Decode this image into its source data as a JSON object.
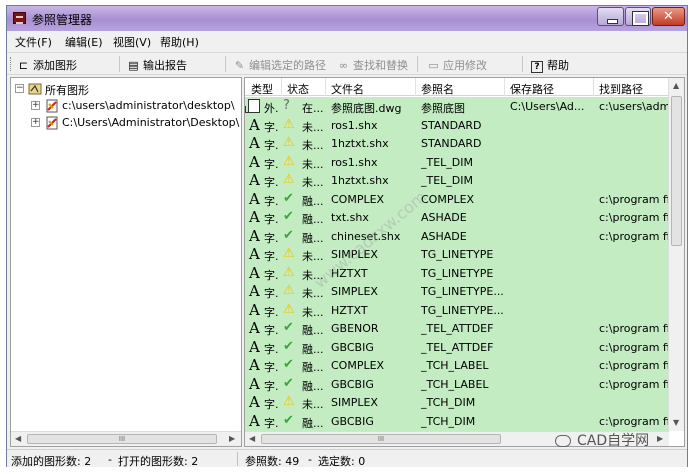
{
  "window": {
    "title": "参照管理器"
  },
  "menu": [
    {
      "label": "文件(F)"
    },
    {
      "label": "编辑(E)"
    },
    {
      "label": "视图(V)"
    },
    {
      "label": "帮助(H)"
    }
  ],
  "toolbar": {
    "add_drawing": "添加图形",
    "output_report": "输出报告",
    "edit_selected_path": "编辑选定的路径",
    "find_replace": "查找和替换",
    "apply_changes": "应用修改",
    "help": "帮助"
  },
  "tree": {
    "root_label": "所有图形",
    "items": [
      {
        "label": "c:\\users\\administrator\\desktop\\"
      },
      {
        "label": "C:\\Users\\Administrator\\Desktop\\"
      }
    ]
  },
  "list": {
    "columns": [
      "类型",
      "状态",
      "文件名",
      "参照名",
      "保存路径",
      "找到路径"
    ],
    "rows": [
      {
        "type_icon": "document-icon",
        "type": "外.",
        "status_icon": "question-icon",
        "status": "在...",
        "file": "参照底图.dwg",
        "ref": "参照底图",
        "save_path": "C:\\Users\\Ad...",
        "found_path": "c:\\users\\admir"
      },
      {
        "type_icon": "font-icon",
        "type": "字.",
        "status_icon": "warning-icon",
        "status": "未...",
        "file": "ros1.shx",
        "ref": "STANDARD",
        "save_path": "",
        "found_path": ""
      },
      {
        "type_icon": "font-icon",
        "type": "字.",
        "status_icon": "warning-icon",
        "status": "未...",
        "file": "1hztxt.shx",
        "ref": "STANDARD",
        "save_path": "",
        "found_path": ""
      },
      {
        "type_icon": "font-icon",
        "type": "字.",
        "status_icon": "warning-icon",
        "status": "未...",
        "file": "ros1.shx",
        "ref": "_TEL_DIM",
        "save_path": "",
        "found_path": ""
      },
      {
        "type_icon": "font-icon",
        "type": "字.",
        "status_icon": "warning-icon",
        "status": "未...",
        "file": "1hztxt.shx",
        "ref": "_TEL_DIM",
        "save_path": "",
        "found_path": ""
      },
      {
        "type_icon": "font-icon",
        "type": "字.",
        "status_icon": "check-icon",
        "status": "融...",
        "file": "COMPLEX",
        "ref": "COMPLEX",
        "save_path": "",
        "found_path": "c:\\program file"
      },
      {
        "type_icon": "font-icon",
        "type": "字.",
        "status_icon": "check-icon",
        "status": "融...",
        "file": "txt.shx",
        "ref": "ASHADE",
        "save_path": "",
        "found_path": "c:\\program file"
      },
      {
        "type_icon": "font-icon",
        "type": "字.",
        "status_icon": "check-icon",
        "status": "融...",
        "file": "chineset.shx",
        "ref": "ASHADE",
        "save_path": "",
        "found_path": "c:\\program file"
      },
      {
        "type_icon": "font-icon",
        "type": "字.",
        "status_icon": "warning-icon",
        "status": "未...",
        "file": "SIMPLEX",
        "ref": "TG_LINETYPE",
        "save_path": "",
        "found_path": ""
      },
      {
        "type_icon": "font-icon",
        "type": "字.",
        "status_icon": "warning-icon",
        "status": "未...",
        "file": "HZTXT",
        "ref": "TG_LINETYPE",
        "save_path": "",
        "found_path": ""
      },
      {
        "type_icon": "font-icon",
        "type": "字.",
        "status_icon": "warning-icon",
        "status": "未...",
        "file": "SIMPLEX",
        "ref": "TG_LINETYPE...",
        "save_path": "",
        "found_path": ""
      },
      {
        "type_icon": "font-icon",
        "type": "字.",
        "status_icon": "warning-icon",
        "status": "未...",
        "file": "HZTXT",
        "ref": "TG_LINETYPE...",
        "save_path": "",
        "found_path": ""
      },
      {
        "type_icon": "font-icon",
        "type": "字.",
        "status_icon": "check-icon",
        "status": "融...",
        "file": "GBENOR",
        "ref": "_TEL_ATTDEF",
        "save_path": "",
        "found_path": "c:\\program file"
      },
      {
        "type_icon": "font-icon",
        "type": "字.",
        "status_icon": "check-icon",
        "status": "融...",
        "file": "GBCBIG",
        "ref": "_TEL_ATTDEF",
        "save_path": "",
        "found_path": "c:\\program file"
      },
      {
        "type_icon": "font-icon",
        "type": "字.",
        "status_icon": "check-icon",
        "status": "融...",
        "file": "COMPLEX",
        "ref": "_TCH_LABEL",
        "save_path": "",
        "found_path": "c:\\program file"
      },
      {
        "type_icon": "font-icon",
        "type": "字.",
        "status_icon": "check-icon",
        "status": "融...",
        "file": "GBCBIG",
        "ref": "_TCH_LABEL",
        "save_path": "",
        "found_path": "c:\\program file"
      },
      {
        "type_icon": "font-icon",
        "type": "字.",
        "status_icon": "warning-icon",
        "status": "未...",
        "file": "SIMPLEX",
        "ref": "_TCH_DIM",
        "save_path": "",
        "found_path": ""
      },
      {
        "type_icon": "font-icon",
        "type": "字.",
        "status_icon": "check-icon",
        "status": "融...",
        "file": "GBCBIG",
        "ref": "_TCH_DIM",
        "save_path": "",
        "found_path": "c:\\program file"
      }
    ]
  },
  "statusbar": {
    "added_drawings": "添加的图形数: 2",
    "opened_drawings": "打开的图形数: 2",
    "ref_count": "参照数: 49",
    "selected_count": "选定数: 0"
  },
  "watermark": {
    "logo_text": "CAD自学网",
    "diagonal_text": "www.cadzxw.com"
  },
  "colors": {
    "list_bg": "#c3ecc3",
    "warning": "#f2c200",
    "check": "#3aa63a",
    "question": "#6a6a6a"
  }
}
